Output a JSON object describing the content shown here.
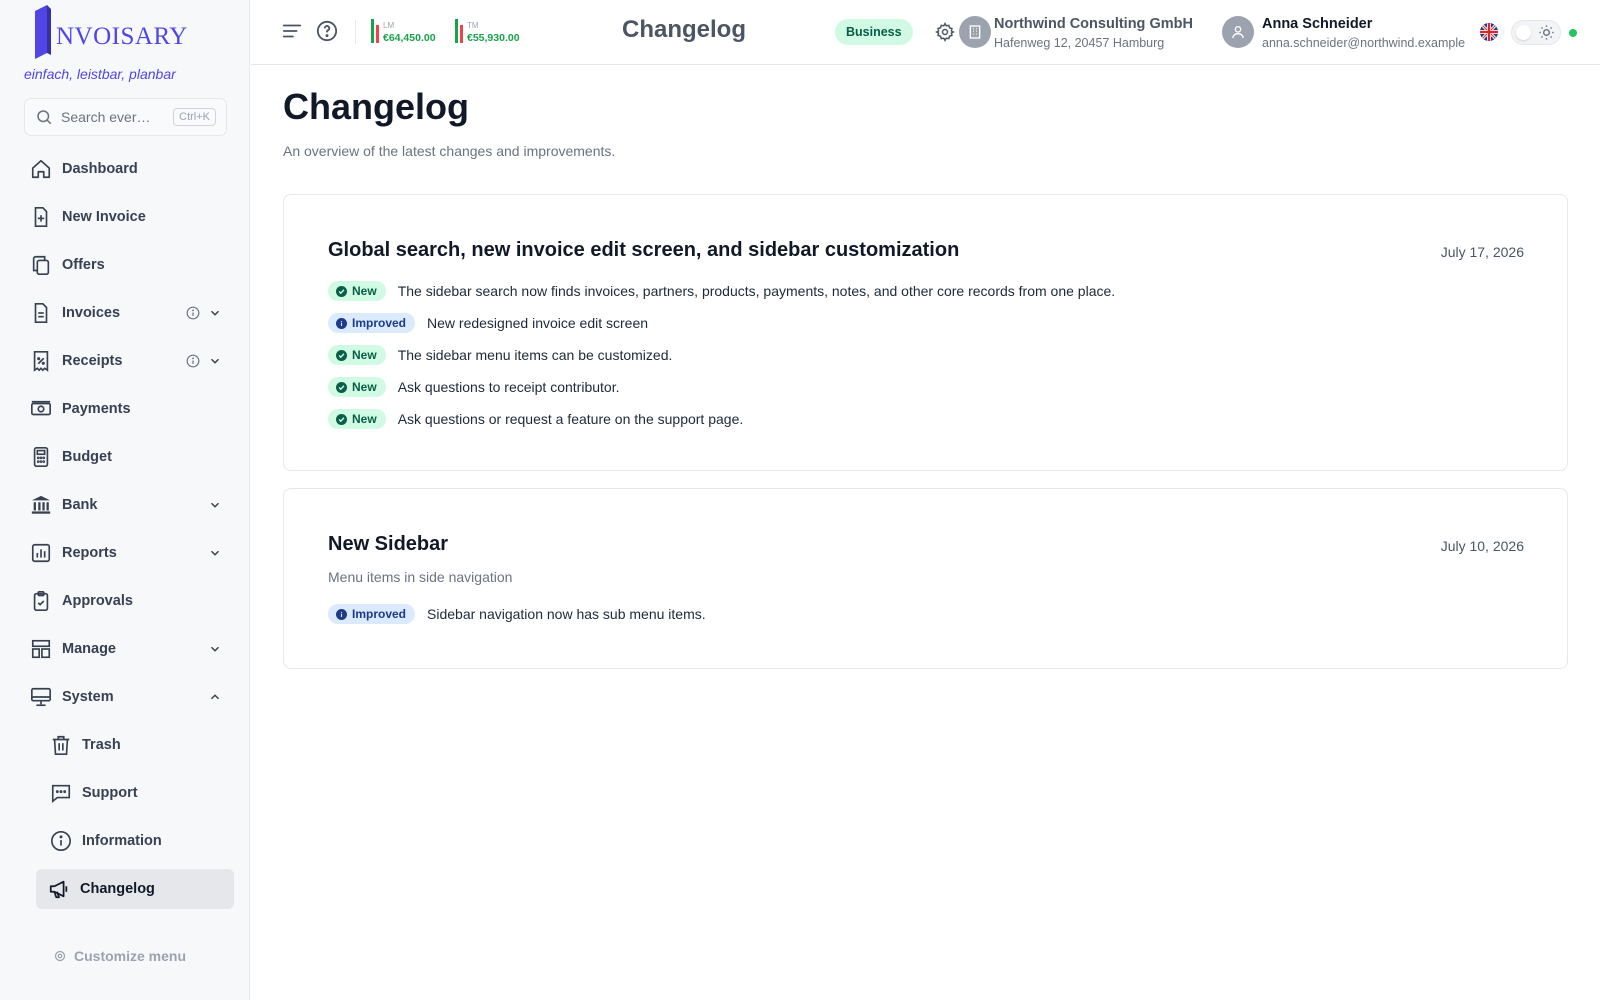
{
  "app": {
    "logo_text": "NVOISARY",
    "tagline": "einfach, leistbar, planbar"
  },
  "search": {
    "placeholder": "Search ever…",
    "shortcut": "Ctrl+K"
  },
  "sidebar": {
    "items": [
      {
        "label": "Dashboard",
        "icon": "home-icon"
      },
      {
        "label": "New Invoice",
        "icon": "file-plus-icon"
      },
      {
        "label": "Offers",
        "icon": "copy-icon"
      },
      {
        "label": "Invoices",
        "icon": "file-text-icon",
        "info": true,
        "expandable": true
      },
      {
        "label": "Receipts",
        "icon": "receipt-icon",
        "info": true,
        "expandable": true
      },
      {
        "label": "Payments",
        "icon": "banknote-icon"
      },
      {
        "label": "Budget",
        "icon": "calculator-icon"
      },
      {
        "label": "Bank",
        "icon": "bank-icon",
        "expandable": true
      },
      {
        "label": "Reports",
        "icon": "bar-chart-icon",
        "expandable": true
      },
      {
        "label": "Approvals",
        "icon": "clipboard-check-icon"
      },
      {
        "label": "Manage",
        "icon": "layout-icon",
        "expandable": true
      },
      {
        "label": "System",
        "icon": "monitor-icon",
        "expanded": true
      }
    ],
    "sub_items": [
      {
        "label": "Trash",
        "icon": "trash-icon"
      },
      {
        "label": "Support",
        "icon": "message-icon"
      },
      {
        "label": "Information",
        "icon": "info-icon"
      },
      {
        "label": "Changelog",
        "icon": "megaphone-icon",
        "active": true
      }
    ],
    "customize_label": "Customize menu"
  },
  "topbar": {
    "stats": [
      {
        "label": "LM",
        "value": "€64,450.00"
      },
      {
        "label": "TM",
        "value": "€55,930.00"
      }
    ],
    "title": "Changelog",
    "plan_badge": "Business",
    "company": {
      "name": "Northwind Consulting GmbH",
      "address": "Hafenweg 12, 20457 Hamburg"
    },
    "user": {
      "name": "Anna Schneider",
      "email": "anna.schneider@northwind.example"
    }
  },
  "page": {
    "title": "Changelog",
    "subtitle": "An overview of the latest changes and improvements."
  },
  "changelog": [
    {
      "title": "Global search, new invoice edit screen, and sidebar customization",
      "date": "July 17, 2026",
      "description": "",
      "entries": [
        {
          "tag": "New",
          "type": "new",
          "text": "The sidebar search now finds invoices, partners, products, payments, notes, and other core records from one place."
        },
        {
          "tag": "Improved",
          "type": "improved",
          "text": "New redesigned invoice edit screen"
        },
        {
          "tag": "New",
          "type": "new",
          "text": "The sidebar menu items can be customized."
        },
        {
          "tag": "New",
          "type": "new",
          "text": "Ask questions to receipt contributor."
        },
        {
          "tag": "New",
          "type": "new",
          "text": "Ask questions or request a feature on the support page."
        }
      ]
    },
    {
      "title": "New Sidebar",
      "date": "July 10, 2026",
      "description": "Menu items in side navigation",
      "entries": [
        {
          "tag": "Improved",
          "type": "improved",
          "text": "Sidebar navigation now has sub menu items."
        }
      ]
    }
  ],
  "colors": {
    "brand": "#4f46e5",
    "new_bg": "#d1fae5",
    "new_fg": "#065f46",
    "improved_bg": "#dbeafe",
    "improved_fg": "#1e3a8a",
    "status_online": "#22c55e",
    "stat_positive": "#16a34a"
  }
}
